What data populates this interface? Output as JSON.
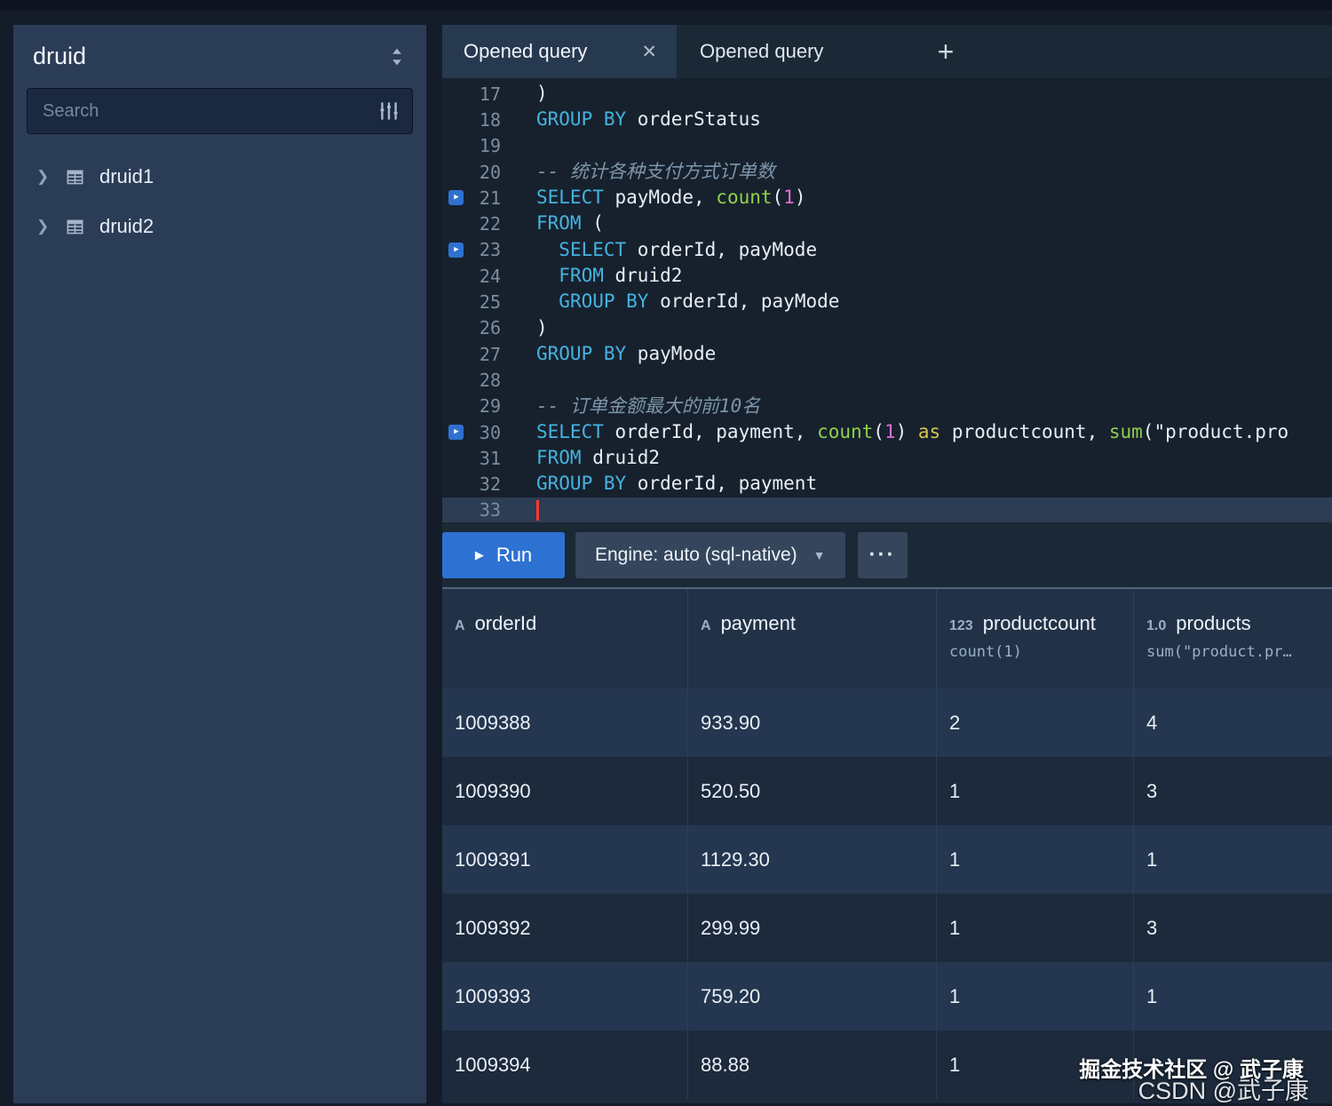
{
  "sidebar": {
    "title": "druid",
    "search": {
      "placeholder": "Search"
    },
    "items": [
      {
        "label": "druid1"
      },
      {
        "label": "druid2"
      }
    ]
  },
  "tabs": {
    "items": [
      {
        "label": "Opened query",
        "active": true
      },
      {
        "label": "Opened query",
        "active": false
      }
    ]
  },
  "editor": {
    "lines": [
      {
        "n": 17,
        "m": false,
        "seg": [
          {
            "t": ")",
            "c": "pl"
          }
        ]
      },
      {
        "n": 18,
        "m": false,
        "seg": [
          {
            "t": "GROUP BY",
            "c": "kw"
          },
          {
            "t": " orderStatus",
            "c": "pl"
          }
        ]
      },
      {
        "n": 19,
        "m": false,
        "seg": []
      },
      {
        "n": 20,
        "m": false,
        "seg": [
          {
            "t": "-- 统计各种支付方式订单数",
            "c": "cm"
          }
        ]
      },
      {
        "n": 21,
        "m": true,
        "seg": [
          {
            "t": "SELECT",
            "c": "kw"
          },
          {
            "t": " payMode, ",
            "c": "pl"
          },
          {
            "t": "count",
            "c": "fn"
          },
          {
            "t": "(",
            "c": "pl"
          },
          {
            "t": "1",
            "c": "nu"
          },
          {
            "t": ")",
            "c": "pl"
          }
        ]
      },
      {
        "n": 22,
        "m": false,
        "seg": [
          {
            "t": "FROM",
            "c": "kw"
          },
          {
            "t": " (",
            "c": "pl"
          }
        ]
      },
      {
        "n": 23,
        "m": true,
        "seg": [
          {
            "t": "  ",
            "c": "pl"
          },
          {
            "t": "SELECT",
            "c": "kw"
          },
          {
            "t": " orderId, payMode",
            "c": "pl"
          }
        ]
      },
      {
        "n": 24,
        "m": false,
        "seg": [
          {
            "t": "  ",
            "c": "pl"
          },
          {
            "t": "FROM",
            "c": "kw"
          },
          {
            "t": " druid2",
            "c": "pl"
          }
        ]
      },
      {
        "n": 25,
        "m": false,
        "seg": [
          {
            "t": "  ",
            "c": "pl"
          },
          {
            "t": "GROUP BY",
            "c": "kw"
          },
          {
            "t": " orderId, payMode",
            "c": "pl"
          }
        ]
      },
      {
        "n": 26,
        "m": false,
        "seg": [
          {
            "t": ")",
            "c": "pl"
          }
        ]
      },
      {
        "n": 27,
        "m": false,
        "seg": [
          {
            "t": "GROUP BY",
            "c": "kw"
          },
          {
            "t": " payMode",
            "c": "pl"
          }
        ]
      },
      {
        "n": 28,
        "m": false,
        "seg": []
      },
      {
        "n": 29,
        "m": false,
        "seg": [
          {
            "t": "-- 订单金额最大的前10名",
            "c": "cm"
          }
        ]
      },
      {
        "n": 30,
        "m": true,
        "seg": [
          {
            "t": "SELECT",
            "c": "kw"
          },
          {
            "t": " orderId, payment, ",
            "c": "pl"
          },
          {
            "t": "count",
            "c": "fn"
          },
          {
            "t": "(",
            "c": "pl"
          },
          {
            "t": "1",
            "c": "nu"
          },
          {
            "t": ") ",
            "c": "pl"
          },
          {
            "t": "as",
            "c": "op"
          },
          {
            "t": " productcount, ",
            "c": "pl"
          },
          {
            "t": "sum",
            "c": "fn"
          },
          {
            "t": "(\"product.pro",
            "c": "pl"
          }
        ]
      },
      {
        "n": 31,
        "m": false,
        "seg": [
          {
            "t": "FROM",
            "c": "kw"
          },
          {
            "t": " druid2",
            "c": "pl"
          }
        ]
      },
      {
        "n": 32,
        "m": false,
        "seg": [
          {
            "t": "GROUP BY",
            "c": "kw"
          },
          {
            "t": " orderId, payment",
            "c": "pl"
          }
        ]
      },
      {
        "n": 33,
        "m": false,
        "active": true,
        "cursor": true,
        "seg": []
      }
    ]
  },
  "controls": {
    "run_label": "Run",
    "engine_label": "Engine: auto (sql-native)"
  },
  "results": {
    "columns": [
      {
        "type": "A",
        "name": "orderId",
        "sub": ""
      },
      {
        "type": "A",
        "name": "payment",
        "sub": ""
      },
      {
        "type": "123",
        "name": "productcount",
        "sub": "count(1)"
      },
      {
        "type": "1.0",
        "name": "products",
        "sub": "sum(\"product.pr…"
      }
    ],
    "rows": [
      [
        "1009388",
        "933.90",
        "2",
        "4"
      ],
      [
        "1009390",
        "520.50",
        "1",
        "3"
      ],
      [
        "1009391",
        "1129.30",
        "1",
        "1"
      ],
      [
        "1009392",
        "299.99",
        "1",
        "3"
      ],
      [
        "1009393",
        "759.20",
        "1",
        "1"
      ],
      [
        "1009394",
        "88.88",
        "1",
        ""
      ]
    ]
  },
  "watermark": {
    "line1": "掘金技术社区 @ 武子康",
    "line2": "CSDN @武子康"
  },
  "colors": {
    "accent_blue": "#2d72d2",
    "keyword": "#45b3e0",
    "function": "#8fd14f",
    "number": "#e06ed5",
    "comment": "#7d95a9",
    "cursor": "#ff3b30"
  }
}
